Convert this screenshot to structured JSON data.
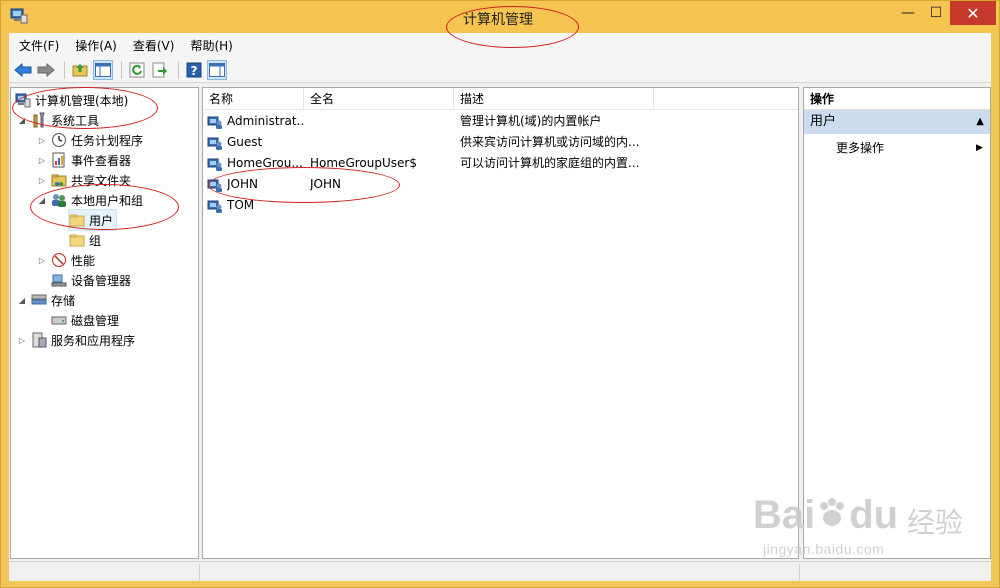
{
  "window": {
    "title": "计算机管理",
    "minimize_glyph": "—",
    "maximize_glyph": "☐",
    "close_glyph": "✕"
  },
  "menu": [
    "文件(F)",
    "操作(A)",
    "查看(V)",
    "帮助(H)"
  ],
  "toolbar": {
    "buttons": [
      "back-icon",
      "forward-icon",
      "up-folder-icon",
      "show-hide-console-tree-icon",
      "refresh-icon",
      "export-list-icon",
      "help-icon",
      "show-hide-action-pane-icon"
    ]
  },
  "tree": {
    "root": "计算机管理(本地)",
    "system_tools": "系统工具",
    "task_scheduler": "任务计划程序",
    "event_viewer": "事件查看器",
    "shared_folders": "共享文件夹",
    "local_users_groups": "本地用户和组",
    "users": "用户",
    "groups": "组",
    "performance": "性能",
    "device_manager": "设备管理器",
    "storage": "存储",
    "disk_management": "磁盘管理",
    "services_apps": "服务和应用程序"
  },
  "list": {
    "columns": [
      "名称",
      "全名",
      "描述"
    ],
    "rows": [
      {
        "name": "Administrat...",
        "fullname": "",
        "desc": "管理计算机(域)的内置帐户"
      },
      {
        "name": "Guest",
        "fullname": "",
        "desc": "供来宾访问计算机或访问域的内..."
      },
      {
        "name": "HomeGrou...",
        "fullname": "HomeGroupUser$",
        "desc": "可以访问计算机的家庭组的内置..."
      },
      {
        "name": "JOHN",
        "fullname": "JOHN",
        "desc": ""
      },
      {
        "name": "TOM",
        "fullname": "",
        "desc": ""
      }
    ]
  },
  "actions": {
    "header": "操作",
    "group": "用户",
    "more": "更多操作"
  },
  "watermark": {
    "brand": "Bai",
    "brand2": "du",
    "cn": "经验",
    "url": "jingyan.baidu.com"
  },
  "colors": {
    "title_bar": "#f5c451",
    "close_button": "#c7392b",
    "annotation": "#d41f1f",
    "action_group": "#cbdcee"
  }
}
